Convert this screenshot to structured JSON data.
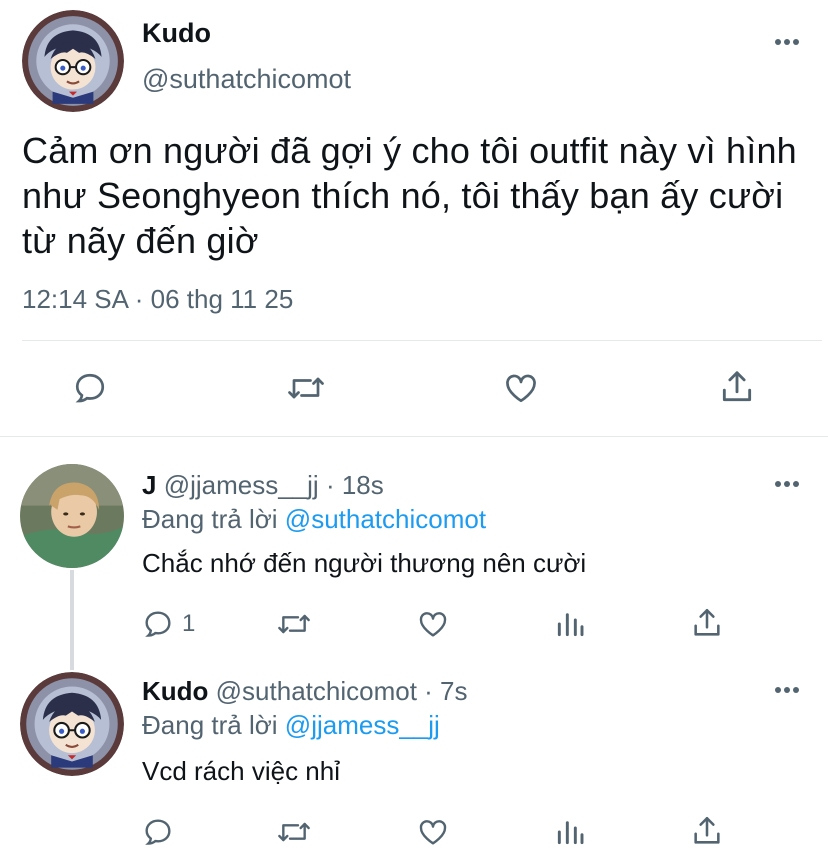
{
  "main_tweet": {
    "name": "Kudo",
    "handle": "@suthatchicomot",
    "text": "Cảm ơn người đã gợi ý cho tôi outfit này vì hình như Seonghyeon thích nó, tôi thấy bạn ấy cười từ nãy đến giờ",
    "timestamp": "12:14 SA · 06 thg 11 25"
  },
  "replies": [
    {
      "name": "J",
      "handle": "@jjamess__jj",
      "time": "· 18s",
      "replying_prefix": "Đang trả lời",
      "replying_to": "@suthatchicomot",
      "text": "Chắc nhớ đến người thương nên cười",
      "reply_count": "1"
    },
    {
      "name": "Kudo",
      "handle": "@suthatchicomot",
      "time": "· 7s",
      "replying_prefix": "Đang trả lời",
      "replying_to": "@jjamess__jj",
      "text": "Vcd rách việc nhỉ",
      "reply_count": ""
    }
  ],
  "icons": {
    "reply": "speech-bubble-icon",
    "retweet": "retweet-icon",
    "like": "heart-icon",
    "share": "share-icon",
    "analytics": "bar-chart-icon",
    "more": "ellipsis-icon"
  },
  "colors": {
    "link": "#1d9bf0",
    "secondary_text": "#536471",
    "primary_text": "#0f1419"
  }
}
